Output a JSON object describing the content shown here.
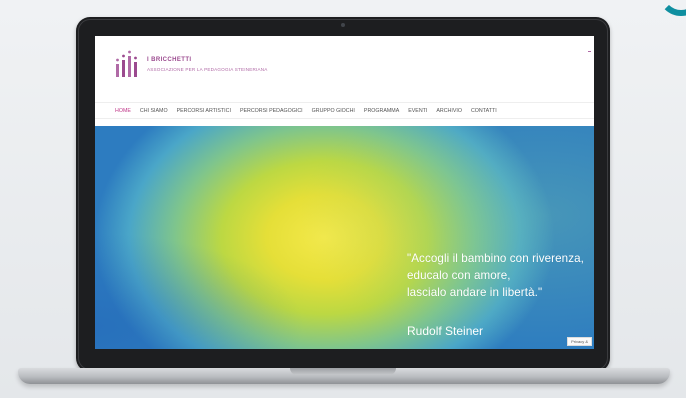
{
  "site": {
    "brand_name": "I BRICCHETTI",
    "brand_sub": "ASSOCIAZIONE PER LA PEDAGOGIA STEINERIANA"
  },
  "nav": {
    "items": [
      {
        "label": "HOME",
        "active": true
      },
      {
        "label": "CHI SIAMO",
        "active": false
      },
      {
        "label": "PERCORSI ARTISTICI",
        "active": false
      },
      {
        "label": "PERCORSI PEDAGOGICI",
        "active": false
      },
      {
        "label": "GRUPPO GIOCHI",
        "active": false
      },
      {
        "label": "PROGRAMMA",
        "active": false
      },
      {
        "label": "EVENTI",
        "active": false
      },
      {
        "label": "ARCHIVIO",
        "active": false
      },
      {
        "label": "CONTATTI",
        "active": false
      }
    ]
  },
  "hero": {
    "quote_lines": [
      "\"Accogli il bambino con riverenza,",
      "educalo con amore,",
      "lascialo andare in libertà.\""
    ],
    "author": "Rudolf Steiner",
    "privacy_label": "Privacy &"
  },
  "colors": {
    "accent": "#c0398a",
    "brand": "#9b4a8f"
  }
}
